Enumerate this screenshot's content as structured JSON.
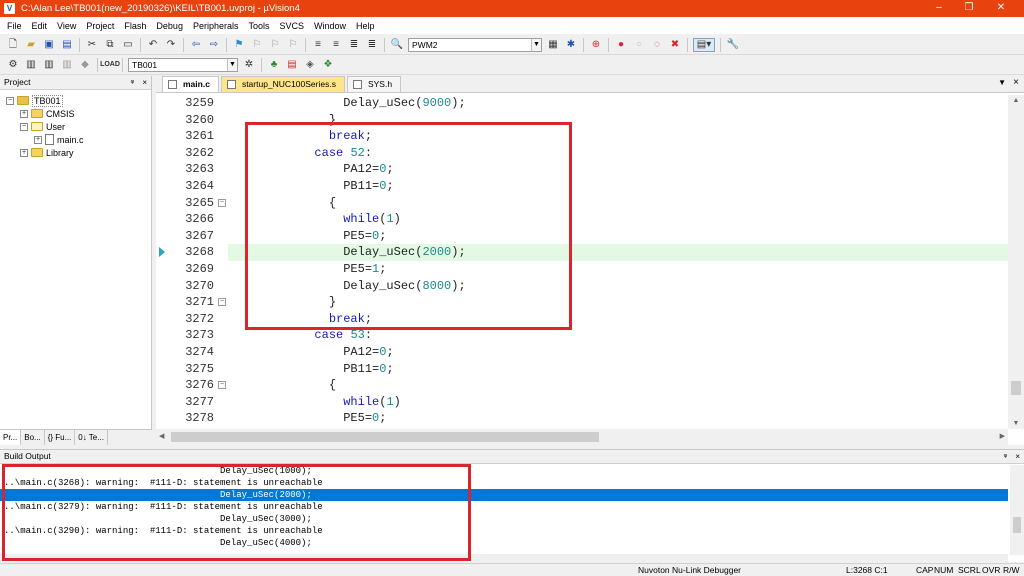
{
  "window": {
    "title": "C:\\Alan Lee\\TB001(new_20190326)\\KEIL\\TB001.uvproj - µVision4",
    "icon_label": "V",
    "controls": [
      "–",
      "❐",
      "✕"
    ]
  },
  "menu": [
    "File",
    "Edit",
    "View",
    "Project",
    "Flash",
    "Debug",
    "Peripherals",
    "Tools",
    "SVCS",
    "Window",
    "Help"
  ],
  "toolbar": {
    "find_value": "PWM2",
    "target_value": "TB001"
  },
  "project_panel": {
    "title": "Project",
    "pin": "ᵠ",
    "close": "×",
    "tree": {
      "root": "TB001",
      "cmsis": "CMSIS",
      "user": "User",
      "main_file": "main.c",
      "library": "Library"
    },
    "tabs": [
      "Pr...",
      "Bo...",
      "{} Fu...",
      "0↓ Te..."
    ]
  },
  "editor": {
    "tabs": [
      "main.c",
      "startup_NUC100Series.s",
      "SYS.h"
    ],
    "active_tab": "main.c",
    "current_line": 3268,
    "lines": [
      {
        "no": "3259",
        "indent": "    ",
        "tokens": [
          {
            "t": "Delay_uSec(",
            "c": ""
          },
          {
            "t": "9000",
            "c": "num"
          },
          {
            "t": ");",
            "c": ""
          }
        ]
      },
      {
        "no": "3260",
        "indent": "  ",
        "tokens": [
          {
            "t": "}",
            "c": ""
          }
        ]
      },
      {
        "no": "3261",
        "indent": "  ",
        "tokens": [
          {
            "t": "break",
            "c": "kw"
          },
          {
            "t": ";",
            "c": ""
          }
        ]
      },
      {
        "no": "3262",
        "indent": "",
        "tokens": [
          {
            "t": "case",
            "c": "kw"
          },
          {
            "t": " ",
            "c": ""
          },
          {
            "t": "52",
            "c": "num"
          },
          {
            "t": ":",
            "c": ""
          }
        ]
      },
      {
        "no": "3263",
        "indent": "    ",
        "tokens": [
          {
            "t": "PA12=",
            "c": ""
          },
          {
            "t": "0",
            "c": "num"
          },
          {
            "t": ";",
            "c": ""
          }
        ]
      },
      {
        "no": "3264",
        "indent": "    ",
        "tokens": [
          {
            "t": "PB11=",
            "c": ""
          },
          {
            "t": "0",
            "c": "num"
          },
          {
            "t": ";",
            "c": ""
          }
        ]
      },
      {
        "no": "3265",
        "indent": "  ",
        "fold": true,
        "tokens": [
          {
            "t": "{",
            "c": ""
          }
        ]
      },
      {
        "no": "3266",
        "indent": "    ",
        "tokens": [
          {
            "t": "while",
            "c": "kw"
          },
          {
            "t": "(",
            "c": ""
          },
          {
            "t": "1",
            "c": "num"
          },
          {
            "t": ")",
            "c": ""
          }
        ]
      },
      {
        "no": "3267",
        "indent": "    ",
        "tokens": [
          {
            "t": "PE5=",
            "c": ""
          },
          {
            "t": "0",
            "c": "num"
          },
          {
            "t": ";",
            "c": ""
          }
        ]
      },
      {
        "no": "3268",
        "indent": "    ",
        "hl": true,
        "tokens": [
          {
            "t": "Delay_uSec(",
            "c": ""
          },
          {
            "t": "2000",
            "c": "num"
          },
          {
            "t": ");",
            "c": ""
          }
        ]
      },
      {
        "no": "3269",
        "indent": "    ",
        "tokens": [
          {
            "t": "PE5=",
            "c": ""
          },
          {
            "t": "1",
            "c": "num"
          },
          {
            "t": ";",
            "c": ""
          }
        ]
      },
      {
        "no": "3270",
        "indent": "    ",
        "tokens": [
          {
            "t": "Delay_uSec(",
            "c": ""
          },
          {
            "t": "8000",
            "c": "num"
          },
          {
            "t": ");",
            "c": ""
          }
        ]
      },
      {
        "no": "3271",
        "indent": "  ",
        "fold": true,
        "tokens": [
          {
            "t": "}",
            "c": ""
          }
        ]
      },
      {
        "no": "3272",
        "indent": "  ",
        "tokens": [
          {
            "t": "break",
            "c": "kw"
          },
          {
            "t": ";",
            "c": ""
          }
        ]
      },
      {
        "no": "3273",
        "indent": "",
        "tokens": [
          {
            "t": "case",
            "c": "kw"
          },
          {
            "t": " ",
            "c": ""
          },
          {
            "t": "53",
            "c": "num"
          },
          {
            "t": ":",
            "c": ""
          }
        ]
      },
      {
        "no": "3274",
        "indent": "    ",
        "tokens": [
          {
            "t": "PA12=",
            "c": ""
          },
          {
            "t": "0",
            "c": "num"
          },
          {
            "t": ";",
            "c": ""
          }
        ]
      },
      {
        "no": "3275",
        "indent": "    ",
        "tokens": [
          {
            "t": "PB11=",
            "c": ""
          },
          {
            "t": "0",
            "c": "num"
          },
          {
            "t": ";",
            "c": ""
          }
        ]
      },
      {
        "no": "3276",
        "indent": "  ",
        "fold": true,
        "tokens": [
          {
            "t": "{",
            "c": ""
          }
        ]
      },
      {
        "no": "3277",
        "indent": "    ",
        "tokens": [
          {
            "t": "while",
            "c": "kw"
          },
          {
            "t": "(",
            "c": ""
          },
          {
            "t": "1",
            "c": "num"
          },
          {
            "t": ")",
            "c": ""
          }
        ]
      },
      {
        "no": "3278",
        "indent": "    ",
        "tokens": [
          {
            "t": "PE5=",
            "c": ""
          },
          {
            "t": "0",
            "c": "num"
          },
          {
            "t": ";",
            "c": ""
          }
        ]
      }
    ]
  },
  "build_output": {
    "title": "Build Output",
    "pin": "ᵠ",
    "close": "×",
    "lines": [
      {
        "text": "                                        Delay_uSec(1000);",
        "selected": false
      },
      {
        "text": "..\\main.c(3268): warning:  #111-D: statement is unreachable",
        "selected": false
      },
      {
        "text": "                                        Delay_uSec(2000);",
        "selected": true
      },
      {
        "text": "..\\main.c(3279): warning:  #111-D: statement is unreachable",
        "selected": false
      },
      {
        "text": "                                        Delay_uSec(3000);",
        "selected": false
      },
      {
        "text": "..\\main.c(3290): warning:  #111-D: statement is unreachable",
        "selected": false
      },
      {
        "text": "                                        Delay_uSec(4000);",
        "selected": false
      }
    ]
  },
  "status_bar": {
    "debugger": "Nuvoton Nu-Link Debugger",
    "position": "L:3268 C:1",
    "caps": "CAP",
    "num": "NUM",
    "scrl": "SCRL",
    "ovr": "OVR",
    "rw": "R/W"
  },
  "colors": {
    "titlebar": "#e8420f",
    "highlight_box": "#d9252b",
    "selection": "#0078d7",
    "keyword": "#1818c0",
    "number": "#1a8a8a"
  }
}
